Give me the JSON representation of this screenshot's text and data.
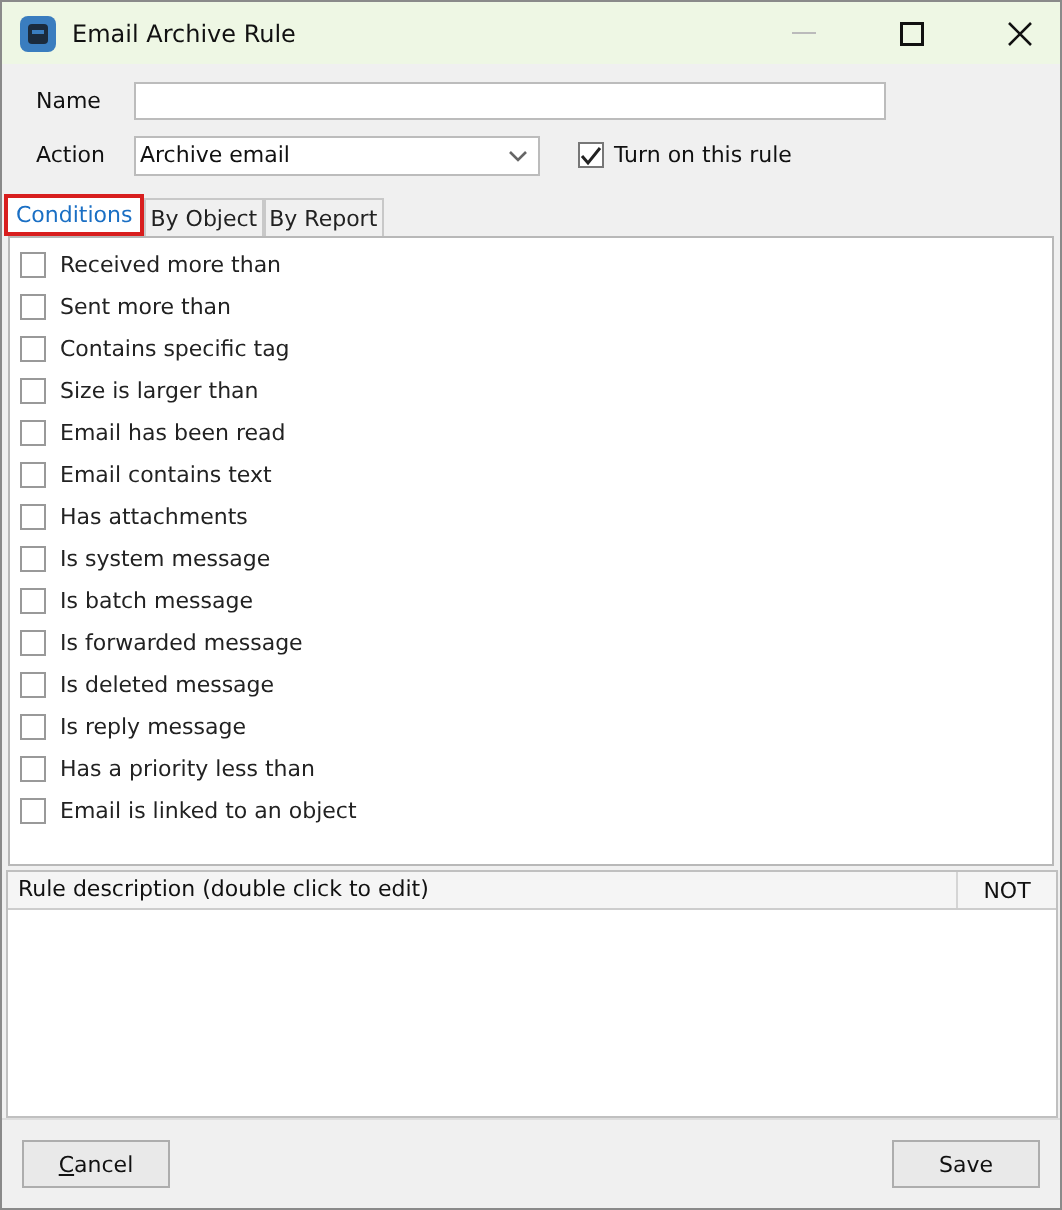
{
  "window": {
    "title": "Email Archive Rule"
  },
  "name_field": {
    "label": "Name"
  },
  "action_field": {
    "label": "Action",
    "value": "Archive email"
  },
  "turn_on": {
    "label": "Turn on this rule",
    "checked": true
  },
  "tabs": [
    {
      "label": "Conditions",
      "selected": true
    },
    {
      "label": "By Object",
      "selected": false
    },
    {
      "label": "By Report",
      "selected": false
    }
  ],
  "conditions": [
    {
      "label": "Received more than",
      "checked": false
    },
    {
      "label": "Sent more than",
      "checked": false
    },
    {
      "label": "Contains specific tag",
      "checked": false
    },
    {
      "label": "Size is larger than",
      "checked": false
    },
    {
      "label": "Email has been read",
      "checked": false
    },
    {
      "label": "Email contains text",
      "checked": false
    },
    {
      "label": "Has attachments",
      "checked": false
    },
    {
      "label": "Is system message",
      "checked": false
    },
    {
      "label": "Is batch message",
      "checked": false
    },
    {
      "label": "Is forwarded message",
      "checked": false
    },
    {
      "label": "Is deleted message",
      "checked": false
    },
    {
      "label": "Is reply message",
      "checked": false
    },
    {
      "label": "Has a priority less than",
      "checked": false
    },
    {
      "label": "Email is linked to an object",
      "checked": false
    }
  ],
  "description_table": {
    "columns": [
      "Rule description (double click to edit)",
      "NOT"
    ]
  },
  "buttons": {
    "cancel": "Cancel",
    "save": "Save"
  }
}
